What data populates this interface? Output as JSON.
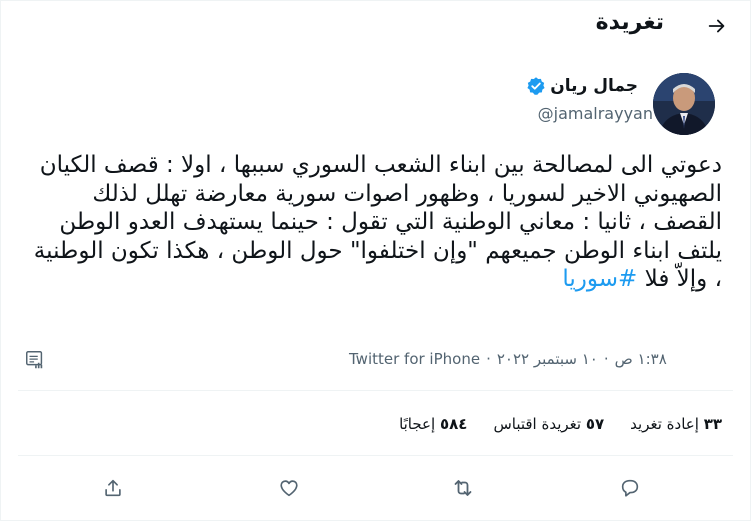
{
  "header": {
    "title": "تغريدة"
  },
  "author": {
    "name": "جمال ريان",
    "handle": "@jamalrayyan",
    "verified": true
  },
  "tweet": {
    "text_main": "دعوتي الى لمصالحة بين ابناء الشعب السوري سببها ، اولا : قصف الكيان الصهيوني الاخير لسوريا ، وظهور اصوات سورية معارضة تهلل لذلك القصف ، ثانيا : معاني الوطنية التي تقول : حينما يستهدف العدو الوطن يلتف ابناء الوطن جميعهم \"وإن اختلفوا\" حول الوطن ، هكذا تكون الوطنية ، وإلاّ فلا",
    "hashtag": "#سوريا"
  },
  "meta": {
    "time": "١:٣٨ ص",
    "date": "١٠ سبتمبر ٢٠٢٢",
    "separator": "·",
    "source": "Twitter for iPhone"
  },
  "stats": {
    "retweets_num": "٣٣",
    "retweets_label": "إعادة تغريد",
    "quotes_num": "٥٧",
    "quotes_label": "تغريدة اقتباس",
    "likes_num": "٥٨٤",
    "likes_label": "إعجابًا"
  },
  "colors": {
    "accent": "#1d9bf0",
    "muted": "#536471",
    "text": "#0f1419",
    "divider": "#eff3f4"
  },
  "icons": {
    "back": "arrow-right-icon",
    "verified": "verified-badge-icon",
    "analytics": "analytics-icon",
    "reply": "reply-icon",
    "retweet": "retweet-icon",
    "like": "heart-icon",
    "share": "share-icon"
  }
}
